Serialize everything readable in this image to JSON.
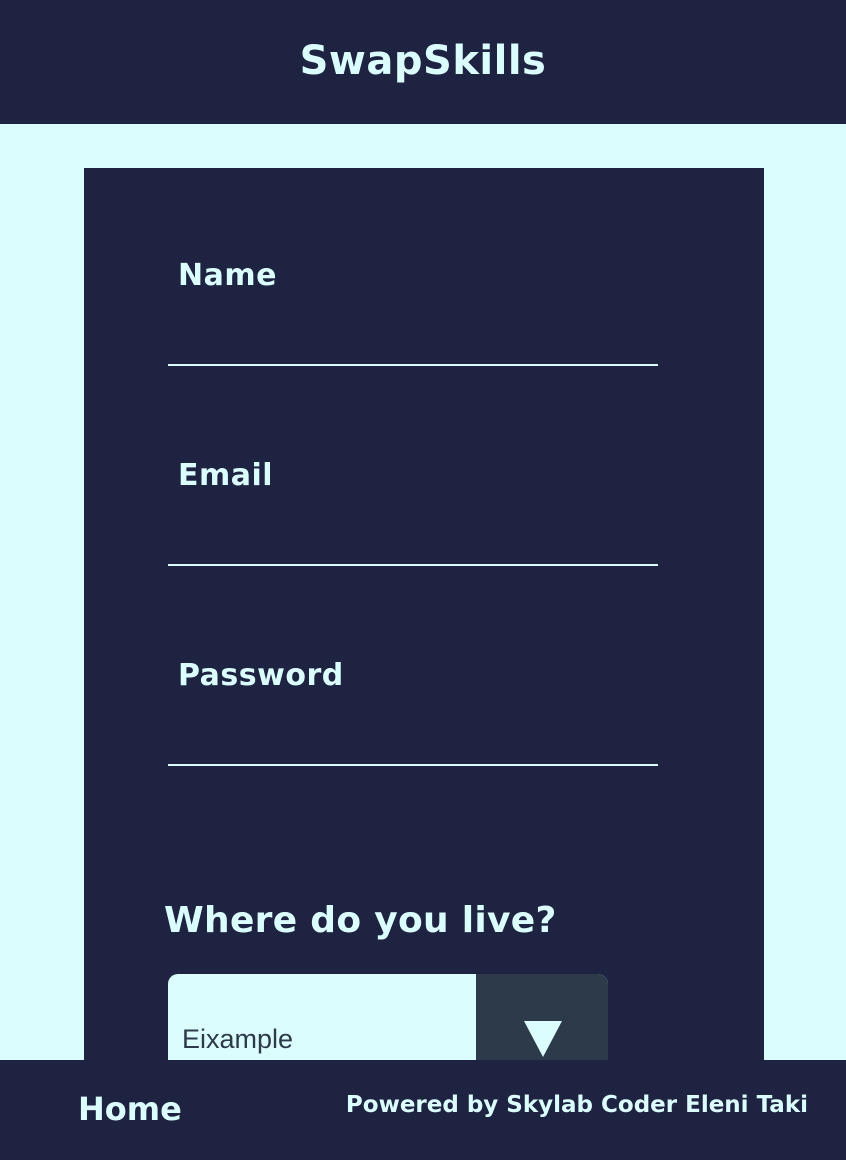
{
  "header": {
    "brand": "SwapSkills"
  },
  "form": {
    "fields": [
      {
        "label": "Name",
        "value": ""
      },
      {
        "label": "Email",
        "value": ""
      },
      {
        "label": "Password",
        "value": ""
      }
    ],
    "location": {
      "question": "Where do you live?",
      "selected": "Eixample",
      "arrow_icon": "triangle-down-icon"
    }
  },
  "footer": {
    "home": "Home",
    "credit": "Powered by Skylab Coder Eleni Taki"
  },
  "colors": {
    "navy": "#1e2341",
    "mint": "#dcfdfd",
    "slate": "#2c3a4a"
  }
}
